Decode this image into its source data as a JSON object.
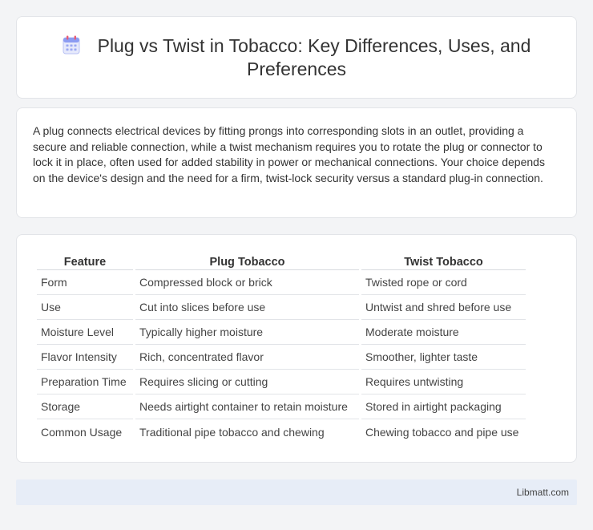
{
  "header": {
    "icon": "calendar-icon",
    "title": "Plug vs Twist in Tobacco: Key Differences, Uses, and Preferences"
  },
  "summary": {
    "text": "A plug connects electrical devices by fitting prongs into corresponding slots in an outlet, providing a secure and reliable connection, while a twist mechanism requires you to rotate the plug or connector to lock it in place, often used for added stability in power or mechanical connections. Your choice depends on the device's design and the need for a firm, twist-lock security versus a standard plug-in connection."
  },
  "table": {
    "headers": [
      "Feature",
      "Plug Tobacco",
      "Twist Tobacco"
    ],
    "rows": [
      [
        "Form",
        "Compressed block or brick",
        "Twisted rope or cord"
      ],
      [
        "Use",
        "Cut into slices before use",
        "Untwist and shred before use"
      ],
      [
        "Moisture Level",
        "Typically higher moisture",
        "Moderate moisture"
      ],
      [
        "Flavor Intensity",
        "Rich, concentrated flavor",
        "Smoother, lighter taste"
      ],
      [
        "Preparation Time",
        "Requires slicing or cutting",
        "Requires untwisting"
      ],
      [
        "Storage",
        "Needs airtight container to retain moisture",
        "Stored in airtight packaging"
      ],
      [
        "Common Usage",
        "Traditional pipe tobacco and chewing",
        "Chewing tobacco and pipe use"
      ]
    ]
  },
  "footer": {
    "site": "Libmatt.com"
  },
  "colors": {
    "background": "#f3f4f6",
    "card": "#ffffff",
    "footer": "#e7edf7",
    "icon_accent": "#7b8ff0"
  }
}
